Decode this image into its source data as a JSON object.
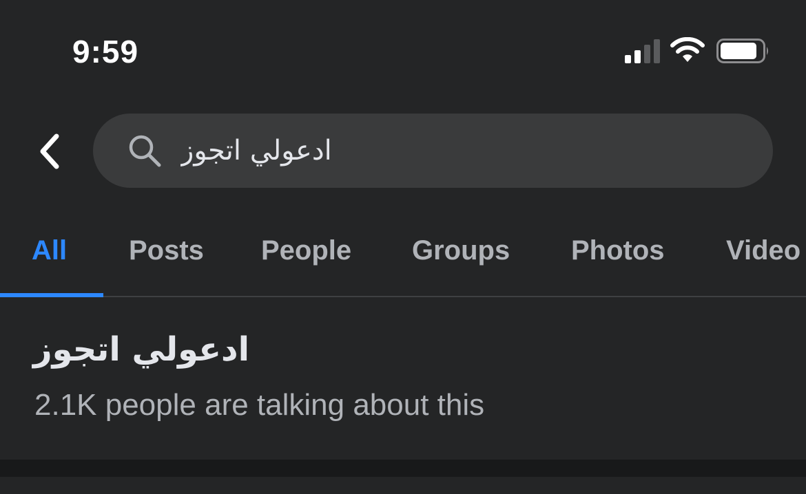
{
  "status_bar": {
    "time": "9:59",
    "icons": [
      "signal-icon",
      "wifi-icon",
      "battery-icon"
    ]
  },
  "search": {
    "back_icon": "chevron-left-icon",
    "icon": "search-icon",
    "value": "ادعولي اتجوز"
  },
  "tabs": [
    {
      "label": "All",
      "active": true
    },
    {
      "label": "Posts",
      "active": false
    },
    {
      "label": "People",
      "active": false
    },
    {
      "label": "Groups",
      "active": false
    },
    {
      "label": "Photos",
      "active": false
    },
    {
      "label": "Video",
      "active": false
    }
  ],
  "result": {
    "title": "ادعولي اتجوز",
    "subtitle": "2.1K people are talking about this"
  },
  "colors": {
    "background": "#242526",
    "accent": "#2d88ff",
    "search_bg": "#3a3b3c",
    "muted_text": "#b0b3b8"
  }
}
